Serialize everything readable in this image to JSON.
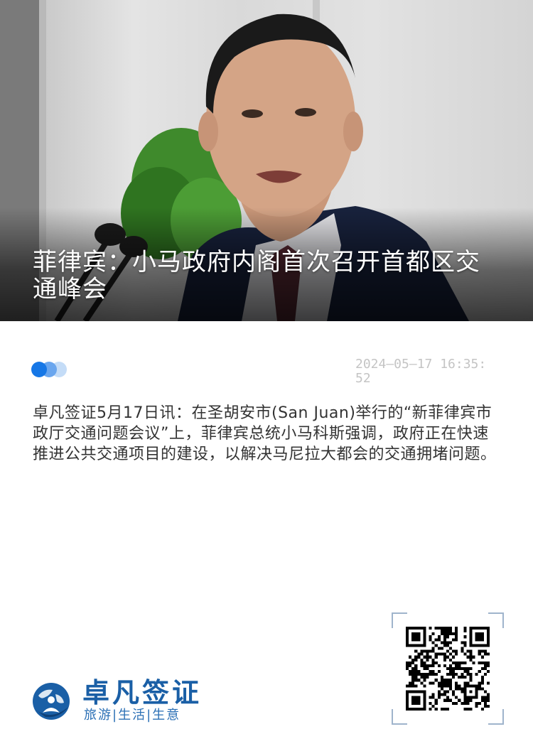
{
  "hero": {
    "title": "菲律宾：小马政府内阁首次召开首都区交通峰会"
  },
  "meta": {
    "date_line1": "2024–05–17 16:35:",
    "date_line2": "52"
  },
  "article": {
    "body": "卓凡签证5月17日讯：在圣胡安市(San Juan)举行的“新菲律宾市政厅交通问题会议”上，菲律宾总统小马科斯强调，政府正在快速推进公共交通项目的建设，以解决马尼拉大都会的交通拥堵问题。"
  },
  "footer": {
    "brand_name": "卓凡签证",
    "slogan": "旅游|生活|生意",
    "qr_icon": "qr-code-icon",
    "logo_icon": "globe-person-logo-icon"
  },
  "colors": {
    "accent": "#1677e6",
    "brand": "#1a5fa6",
    "date": "#c4c4c4",
    "text": "#333333"
  }
}
